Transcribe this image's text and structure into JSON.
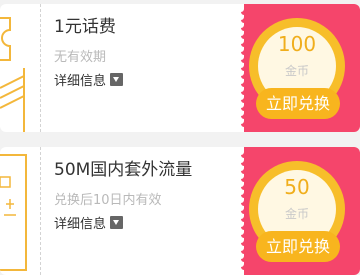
{
  "coupons": [
    {
      "title": "1元话费",
      "subtitle": "无有效期",
      "detail_label": "详细信息",
      "price": "100",
      "currency": "金币",
      "button_label": "立即兑换"
    },
    {
      "title": "50M国内套外流量",
      "subtitle": "兑换后10日内有效",
      "detail_label": "详细信息",
      "price": "50",
      "currency": "金币",
      "button_label": "立即兑换"
    }
  ],
  "colors": {
    "panel": "#f5456b",
    "coin": "#f7be2a",
    "coin_text": "#f0ae1c",
    "button": "#f8b51e",
    "art": "#f3b73b"
  },
  "icons": {
    "detail_toggle": "caret-down-icon",
    "left_art": "coupon-art-icon"
  }
}
